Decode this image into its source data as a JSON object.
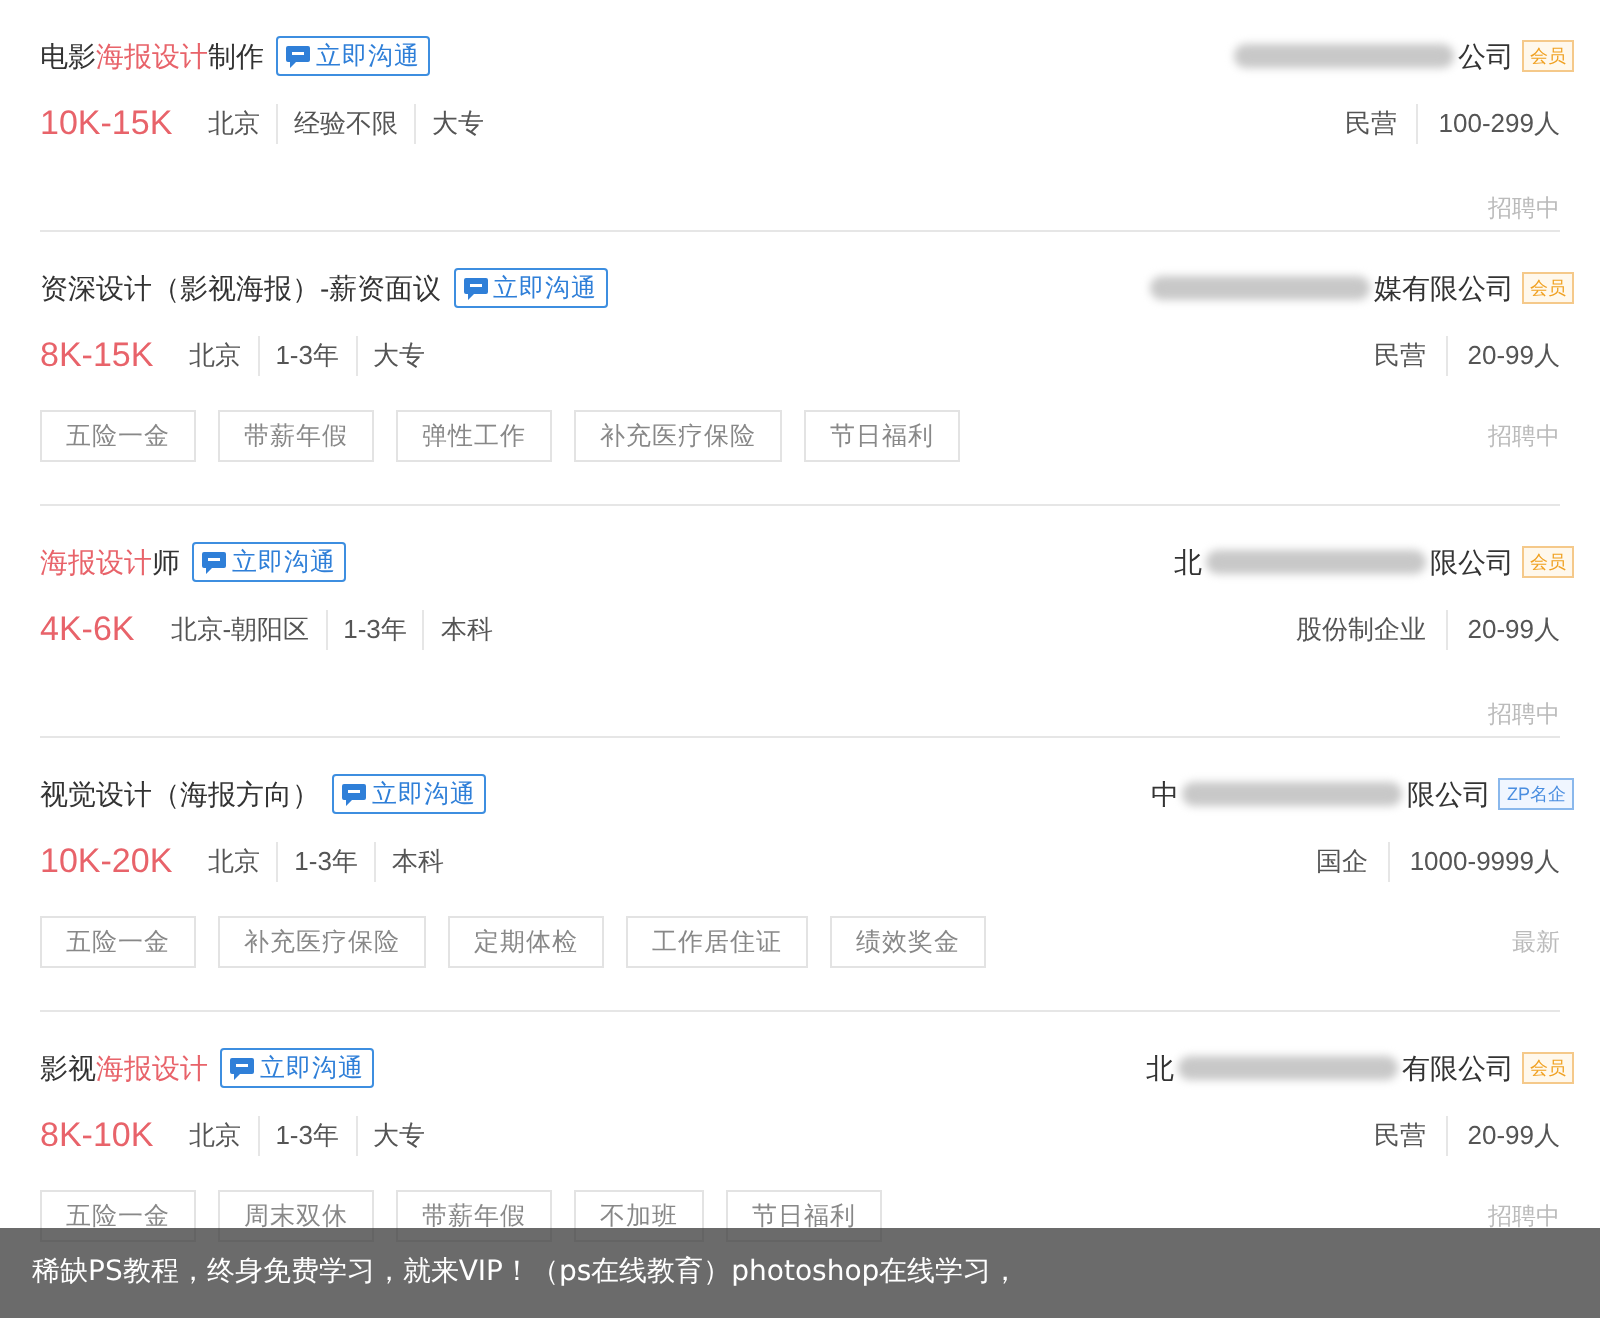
{
  "jobs": [
    {
      "title": [
        {
          "text": "电影",
          "highlight": false
        },
        {
          "text": "海报设计",
          "highlight": true
        },
        {
          "text": "制作",
          "highlight": false
        }
      ],
      "chat": "立即沟通",
      "salary": "10K-15K",
      "meta": [
        "北京",
        "经验不限",
        "大专"
      ],
      "company": {
        "suffix": "公司",
        "badge": {
          "kind": "member",
          "text": "会员"
        }
      },
      "company_meta": [
        "民营",
        "100-299人"
      ],
      "status": "招聘中"
    },
    {
      "title": [
        {
          "text": "资深设计（影视海报）-薪资面议",
          "highlight": false
        }
      ],
      "chat": "立即沟通",
      "salary": "8K-15K",
      "meta": [
        "北京",
        "1-3年",
        "大专"
      ],
      "company": {
        "suffix": "媒有限公司",
        "badge": {
          "kind": "member",
          "text": "会员"
        }
      },
      "company_meta": [
        "民营",
        "20-99人"
      ],
      "tags": [
        "五险一金",
        "带薪年假",
        "弹性工作",
        "补充医疗保险",
        "节日福利"
      ],
      "status": "招聘中"
    },
    {
      "title": [
        {
          "text": "海报设计",
          "highlight": true
        },
        {
          "text": "师",
          "highlight": false
        }
      ],
      "chat": "立即沟通",
      "salary": "4K-6K",
      "meta": [
        "北京-朝阳区",
        "1-3年",
        "本科"
      ],
      "company": {
        "prefix": "北",
        "suffix": "限公司",
        "badge": {
          "kind": "member",
          "text": "会员"
        }
      },
      "company_meta": [
        "股份制企业",
        "20-99人"
      ],
      "status": "招聘中"
    },
    {
      "title": [
        {
          "text": "视觉设计（海报方向）",
          "highlight": false
        }
      ],
      "chat": "立即沟通",
      "salary": "10K-20K",
      "meta": [
        "北京",
        "1-3年",
        "本科"
      ],
      "company": {
        "prefix": "中",
        "suffix": "限公司",
        "badge": {
          "kind": "famous",
          "text": "ZP名企"
        }
      },
      "company_meta": [
        "国企",
        "1000-9999人"
      ],
      "tags": [
        "五险一金",
        "补充医疗保险",
        "定期体检",
        "工作居住证",
        "绩效奖金"
      ],
      "status": "最新"
    },
    {
      "title": [
        {
          "text": "影视",
          "highlight": false
        },
        {
          "text": "海报设计",
          "highlight": true
        }
      ],
      "chat": "立即沟通",
      "salary": "8K-10K",
      "meta": [
        "北京",
        "1-3年",
        "大专"
      ],
      "company": {
        "prefix": "北",
        "suffix": "有限公司",
        "badge": {
          "kind": "member",
          "text": "会员"
        }
      },
      "company_meta": [
        "民营",
        "20-99人"
      ],
      "tags": [
        "五险一金",
        "周末双休",
        "带薪年假",
        "不加班",
        "节日福利"
      ],
      "status": "招聘中"
    }
  ],
  "banner": "稀缺PS教程，终身免费学习，就来VIP！（ps在线教育）photoshop在线学习，"
}
